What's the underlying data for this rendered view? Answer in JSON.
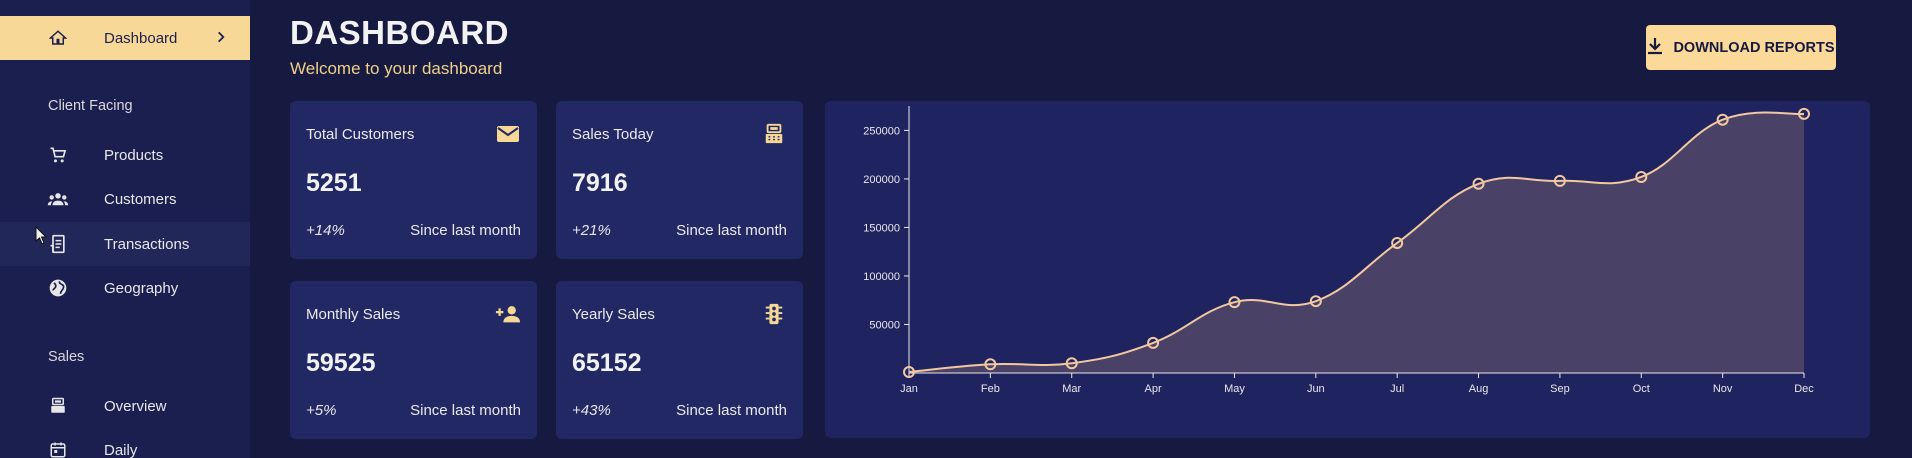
{
  "sidebar": {
    "items": [
      {
        "label": "Dashboard"
      },
      {
        "label": "Products"
      },
      {
        "label": "Customers"
      },
      {
        "label": "Transactions"
      },
      {
        "label": "Geography"
      },
      {
        "label": "Overview"
      },
      {
        "label": "Daily"
      }
    ],
    "sections": [
      "Client Facing",
      "Sales"
    ]
  },
  "header": {
    "title": "DASHBOARD",
    "subtitle": "Welcome to your dashboard",
    "download_label": "DOWNLOAD REPORTS"
  },
  "cards": [
    {
      "title": "Total Customers",
      "value": "5251",
      "change": "+14%",
      "since": "Since last month",
      "icon": "email-icon"
    },
    {
      "title": "Sales Today",
      "value": "7916",
      "change": "+21%",
      "since": "Since last month",
      "icon": "point-of-sale-icon"
    },
    {
      "title": "Monthly Sales",
      "value": "59525",
      "change": "+5%",
      "since": "Since last month",
      "icon": "person-add-icon"
    },
    {
      "title": "Yearly Sales",
      "value": "65152",
      "change": "+43%",
      "since": "Since last month",
      "icon": "traffic-icon"
    }
  ],
  "colors": {
    "accent": "#f8d896",
    "background": "#161a40",
    "sidebar": "#1b1f4f",
    "card": "#222864",
    "line": "#f2c8a0",
    "area": "#4d4466"
  },
  "chart_data": {
    "type": "area",
    "categories": [
      "Jan",
      "Feb",
      "Mar",
      "Apr",
      "May",
      "Jun",
      "Jul",
      "Aug",
      "Sep",
      "Oct",
      "Nov",
      "Dec"
    ],
    "values": [
      1000,
      9000,
      10000,
      31000,
      73000,
      74000,
      134000,
      195000,
      198000,
      202000,
      261000,
      267000
    ],
    "yticks": [
      50000,
      100000,
      150000,
      200000,
      250000
    ],
    "ylim": [
      0,
      270000
    ],
    "grid": false
  }
}
